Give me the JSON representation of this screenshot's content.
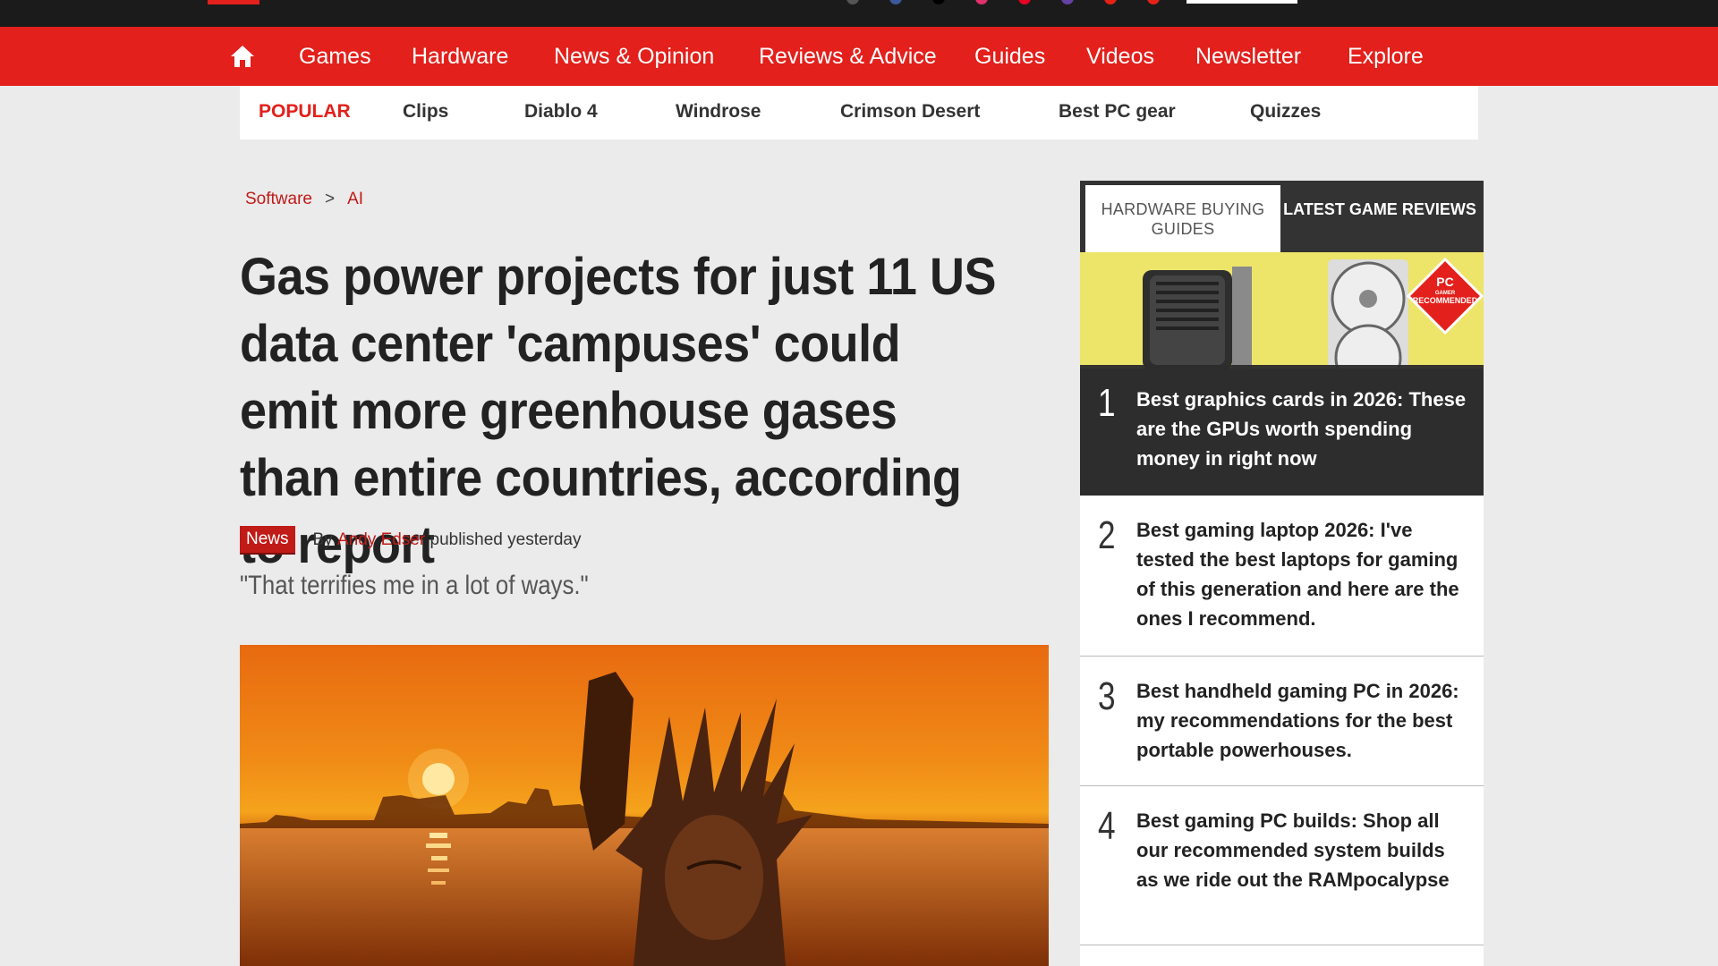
{
  "nav": {
    "items": [
      "Games",
      "Hardware",
      "News & Opinion",
      "Reviews & Advice",
      "Guides",
      "Videos",
      "Newsletter",
      "Explore"
    ]
  },
  "popular": {
    "label": "POPULAR",
    "items": [
      "Clips",
      "Diablo 4",
      "Windrose",
      "Crimson Desert",
      "Best PC gear",
      "Quizzes"
    ]
  },
  "breadcrumb": {
    "items": [
      "Software",
      "AI"
    ],
    "separator": ">"
  },
  "article": {
    "headline": "Gas power projects for just 11 US data center 'campuses' could emit more greenhouse gases than entire countries, according to report",
    "category_badge": "News",
    "by": "By",
    "author": "Andy Edser",
    "published": "published yesterday",
    "strap": "\"That terrifies me in a lot of ways.\""
  },
  "sidebar": {
    "tabs": [
      "HARDWARE BUYING GUIDES",
      "LATEST GAME REVIEWS"
    ],
    "badge": {
      "line1": "PC",
      "line2": "GAMER",
      "line3": "RECOMMENDED"
    },
    "items": [
      {
        "num": "1",
        "text": "Best graphics cards in 2026: These are the GPUs worth spending money in right now"
      },
      {
        "num": "2",
        "text": "Best gaming laptop 2026: I've tested the best laptops for gaming of this generation and here are the ones I recommend."
      },
      {
        "num": "3",
        "text": "Best handheld gaming PC in 2026: my recommendations for the best portable powerhouses."
      },
      {
        "num": "4",
        "text": "Best gaming PC builds: Shop all our recommended system builds as we ride out the RAMpocalypse"
      }
    ]
  },
  "colors": {
    "brand_red": "#e3201b",
    "link_red": "#c01b17",
    "dark": "#1b1b1b"
  }
}
